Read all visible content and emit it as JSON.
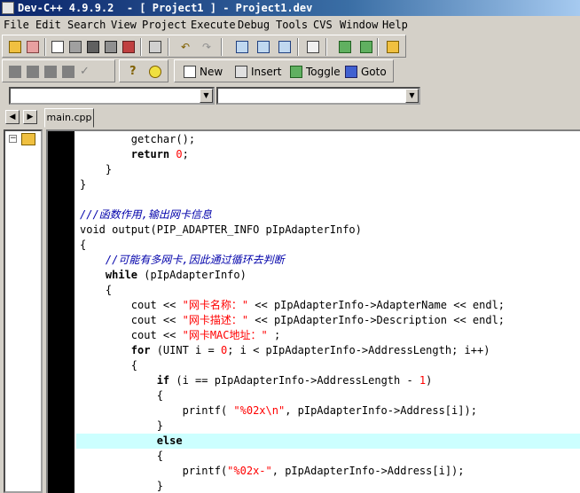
{
  "window": {
    "title": "Dev-C++ 4.9.9.2  - [ Project1 ] - Project1.dev"
  },
  "menu": [
    "File",
    "Edit",
    "Search",
    "View",
    "Project",
    "Execute",
    "Debug",
    "Tools",
    "CVS",
    "Window",
    "Help"
  ],
  "toolbar2": {
    "new_label": "New",
    "insert_label": "Insert",
    "toggle_label": "Toggle",
    "goto_label": "Goto"
  },
  "combos": {
    "left_value": "",
    "right_value": ""
  },
  "tabs": {
    "active_file": "main.cpp"
  },
  "editor": {
    "lines": [
      [
        {
          "t": "        getchar();",
          "c": "bold"
        }
      ],
      [
        {
          "t": "        ",
          "c": ""
        },
        {
          "t": "return",
          "c": "kw"
        },
        {
          "t": " ",
          "c": ""
        },
        {
          "t": "0",
          "c": "num"
        },
        {
          "t": ";",
          "c": ""
        }
      ],
      [
        {
          "t": "    }",
          "c": ""
        }
      ],
      [
        {
          "t": "}",
          "c": ""
        }
      ],
      [
        {
          "t": "",
          "c": ""
        }
      ],
      [
        {
          "t": "///函数作用,输出网卡信息",
          "c": "cm"
        }
      ],
      [
        {
          "t": "void output(PIP_ADAPTER_INFO pIpAdapterInfo)",
          "c": ""
        }
      ],
      [
        {
          "t": "{",
          "c": ""
        }
      ],
      [
        {
          "t": "    //可能有多网卡,因此通过循环去判断",
          "c": "cm"
        }
      ],
      [
        {
          "t": "    ",
          "c": ""
        },
        {
          "t": "while",
          "c": "kw"
        },
        {
          "t": " (pIpAdapterInfo)",
          "c": ""
        }
      ],
      [
        {
          "t": "    {",
          "c": ""
        }
      ],
      [
        {
          "t": "        cout << ",
          "c": ""
        },
        {
          "t": "\"网卡名称：\"",
          "c": "str"
        },
        {
          "t": " << pIpAdapterInfo->AdapterName << endl;",
          "c": ""
        }
      ],
      [
        {
          "t": "        cout << ",
          "c": ""
        },
        {
          "t": "\"网卡描述：\"",
          "c": "str"
        },
        {
          "t": " << pIpAdapterInfo->Description << endl;",
          "c": ""
        }
      ],
      [
        {
          "t": "        cout << ",
          "c": ""
        },
        {
          "t": "\"网卡MAC地址：\"",
          "c": "str"
        },
        {
          "t": " ;",
          "c": ""
        }
      ],
      [
        {
          "t": "        ",
          "c": ""
        },
        {
          "t": "for",
          "c": "kw"
        },
        {
          "t": " (UINT i = ",
          "c": ""
        },
        {
          "t": "0",
          "c": "num"
        },
        {
          "t": "; i < pIpAdapterInfo->AddressLength; i++)",
          "c": ""
        }
      ],
      [
        {
          "t": "        {",
          "c": ""
        }
      ],
      [
        {
          "t": "            ",
          "c": ""
        },
        {
          "t": "if",
          "c": "kw"
        },
        {
          "t": " (i == pIpAdapterInfo->AddressLength - ",
          "c": ""
        },
        {
          "t": "1",
          "c": "num"
        },
        {
          "t": ")",
          "c": ""
        }
      ],
      [
        {
          "t": "            {",
          "c": ""
        }
      ],
      [
        {
          "t": "                printf( ",
          "c": ""
        },
        {
          "t": "\"%02x\\n\"",
          "c": "str"
        },
        {
          "t": ", pIpAdapterInfo->Address[i]);",
          "c": ""
        }
      ],
      [
        {
          "t": "            }",
          "c": ""
        }
      ],
      [
        {
          "t": "            ",
          "c": ""
        },
        {
          "t": "else",
          "c": "kw"
        }
      ],
      [
        {
          "t": "            {",
          "c": ""
        }
      ],
      [
        {
          "t": "                printf(",
          "c": ""
        },
        {
          "t": "\"%02x-\"",
          "c": "str"
        },
        {
          "t": ", pIpAdapterInfo->Address[i]);",
          "c": ""
        }
      ],
      [
        {
          "t": "            }",
          "c": ""
        }
      ]
    ]
  },
  "colors": {
    "keyword": "#000000",
    "comment": "#0000aa",
    "string": "#ff0000",
    "highlight_line": "#ccffff",
    "gutter": "#000000"
  }
}
